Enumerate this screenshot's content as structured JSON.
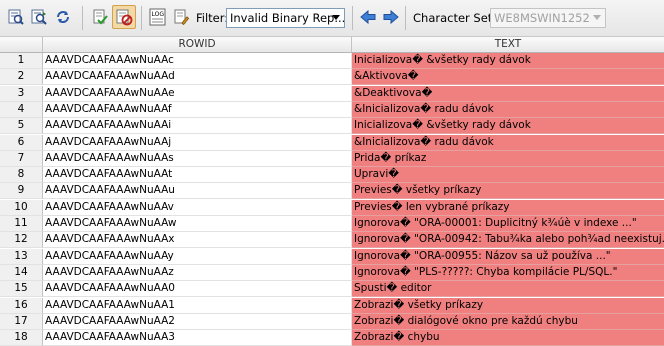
{
  "toolbar": {
    "filter_label": "Filter:",
    "filter_value": "Invalid Binary Rep...",
    "charset_label": "Character Set:",
    "charset_value": "WE8MSWIN1252",
    "icons": [
      "find-icon",
      "find-next-icon",
      "replace-icon",
      "validate-icon",
      "edit-active-icon",
      "log-icon",
      "settings-icon",
      "back-arrow-icon",
      "forward-arrow-icon"
    ]
  },
  "grid": {
    "columns": [
      "ROWID",
      "TEXT"
    ],
    "rows": [
      {
        "n": "1",
        "rowid": "AAAVDCAAFAAAwNuAAc",
        "text": "Inicializova� &všetky rady dávok"
      },
      {
        "n": "2",
        "rowid": "AAAVDCAAFAAAwNuAAd",
        "text": "&Aktivova�"
      },
      {
        "n": "3",
        "rowid": "AAAVDCAAFAAAwNuAAe",
        "text": "&Deaktivova�"
      },
      {
        "n": "4",
        "rowid": "AAAVDCAAFAAAwNuAAf",
        "text": "&Inicializova� radu dávok"
      },
      {
        "n": "5",
        "rowid": "AAAVDCAAFAAAwNuAAi",
        "text": "Inicializova� &všetky rady dávok"
      },
      {
        "n": "6",
        "rowid": "AAAVDCAAFAAAwNuAAj",
        "text": "&Inicializova� radu dávok"
      },
      {
        "n": "7",
        "rowid": "AAAVDCAAFAAAwNuAAs",
        "text": "Prida� príkaz"
      },
      {
        "n": "8",
        "rowid": "AAAVDCAAFAAAwNuAAt",
        "text": "Upravi�"
      },
      {
        "n": "9",
        "rowid": "AAAVDCAAFAAAwNuAAu",
        "text": "Previes� všetky príkazy"
      },
      {
        "n": "10",
        "rowid": "AAAVDCAAFAAAwNuAAv",
        "text": "Previes� len vybrané príkazy"
      },
      {
        "n": "11",
        "rowid": "AAAVDCAAFAAAwNuAAw",
        "text": "Ignorova� \"ORA-00001: Duplicitný k¾úè v indexe ...\""
      },
      {
        "n": "12",
        "rowid": "AAAVDCAAFAAAwNuAAx",
        "text": "Ignorova� \"ORA-00942: Tabu¾ka alebo poh¾ad neexistuj..."
      },
      {
        "n": "13",
        "rowid": "AAAVDCAAFAAAwNuAAy",
        "text": "Ignorova� \"ORA-00955: Názov sa už používa ...\""
      },
      {
        "n": "14",
        "rowid": "AAAVDCAAFAAAwNuAAz",
        "text": "Ignorova� \"PLS-?????: Chyba kompilácie PL/SQL.\""
      },
      {
        "n": "15",
        "rowid": "AAAVDCAAFAAAwNuAA0",
        "text": "Spusti� editor"
      },
      {
        "n": "16",
        "rowid": "AAAVDCAAFAAAwNuAA1",
        "text": "Zobrazi� všetky príkazy"
      },
      {
        "n": "17",
        "rowid": "AAAVDCAAFAAAwNuAA2",
        "text": "Zobrazi� dialógové okno pre každú chybu"
      },
      {
        "n": "18",
        "rowid": "AAAVDCAAFAAAwNuAA3",
        "text": "Zobrazi� chybu"
      }
    ]
  },
  "colors": {
    "invalid_row": "#f08080",
    "toolbar_bg": "#eeeeee",
    "active_button": "#f2d9a6"
  }
}
